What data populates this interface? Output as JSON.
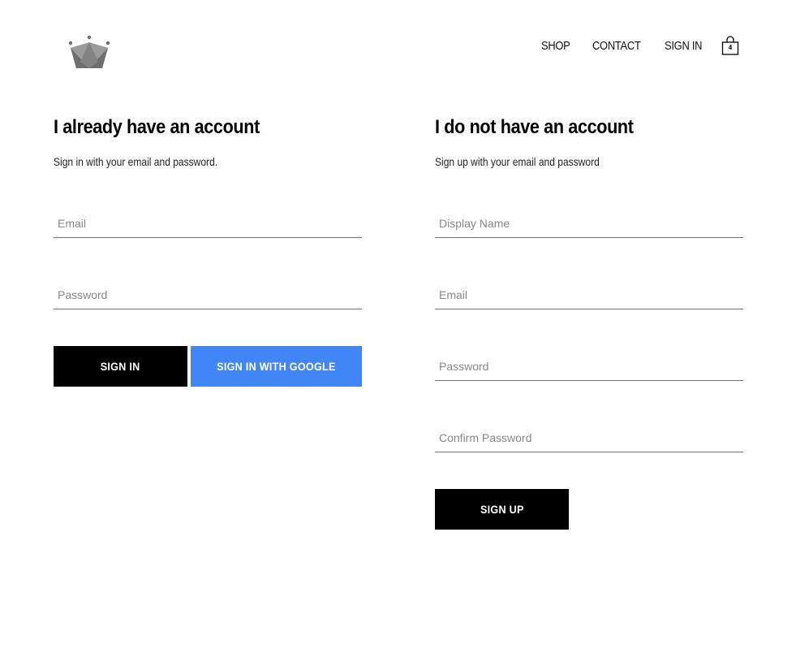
{
  "header": {
    "logo_icon": "crown-icon",
    "nav": {
      "shop": "SHOP",
      "contact": "CONTACT",
      "sign_in": "SIGN IN"
    },
    "cart": {
      "icon": "shopping-bag-icon",
      "count": "4"
    }
  },
  "sign_in": {
    "title": "I already have an account",
    "subtitle": "Sign in with your email and password.",
    "email": {
      "placeholder": "Email",
      "value": ""
    },
    "password": {
      "placeholder": "Password",
      "value": ""
    },
    "sign_in_button": "SIGN IN",
    "google_button": "SIGN IN WITH GOOGLE"
  },
  "sign_up": {
    "title": "I do not have an account",
    "subtitle": "Sign up with your email and password",
    "display_name": {
      "placeholder": "Display Name",
      "value": ""
    },
    "email": {
      "placeholder": "Email",
      "value": ""
    },
    "password": {
      "placeholder": "Password",
      "value": ""
    },
    "confirm_password": {
      "placeholder": "Confirm Password",
      "value": ""
    },
    "sign_up_button": "SIGN UP"
  },
  "colors": {
    "primary_button": "#000000",
    "google_button": "#4285f4",
    "logo": "#7a7a7a"
  }
}
